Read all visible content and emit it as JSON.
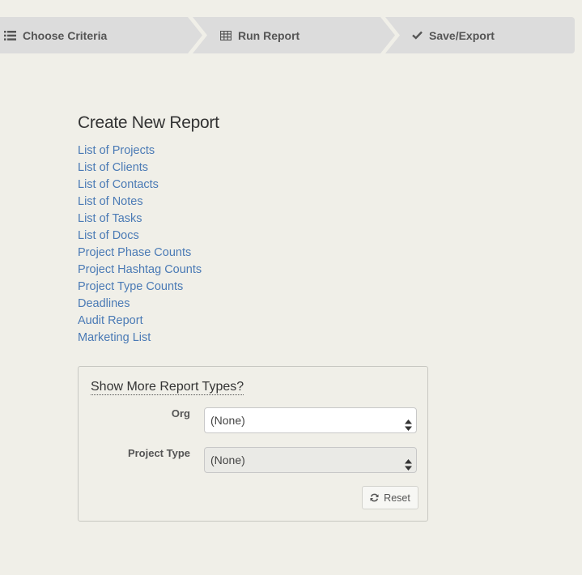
{
  "steps": [
    {
      "label": "Choose Criteria",
      "icon": "list-icon"
    },
    {
      "label": "Run Report",
      "icon": "table-icon"
    },
    {
      "label": "Save/Export",
      "icon": "check-icon"
    }
  ],
  "main": {
    "title": "Create New Report",
    "reports": [
      "List of Projects",
      "List of Clients",
      "List of Contacts",
      "List of Notes",
      "List of Tasks",
      "List of Docs",
      "Project Phase Counts",
      "Project Hashtag Counts",
      "Project Type Counts",
      "Deadlines",
      "Audit Report",
      "Marketing List"
    ]
  },
  "more_types": {
    "title": "Show More Report Types?",
    "org_label": "Org",
    "org_value": "(None)",
    "project_type_label": "Project Type",
    "project_type_value": "(None)",
    "reset_label": "Reset"
  },
  "colors": {
    "link": "#4a7ab5",
    "background": "#f0efe8",
    "steps_bar": "#dcdcdc"
  }
}
